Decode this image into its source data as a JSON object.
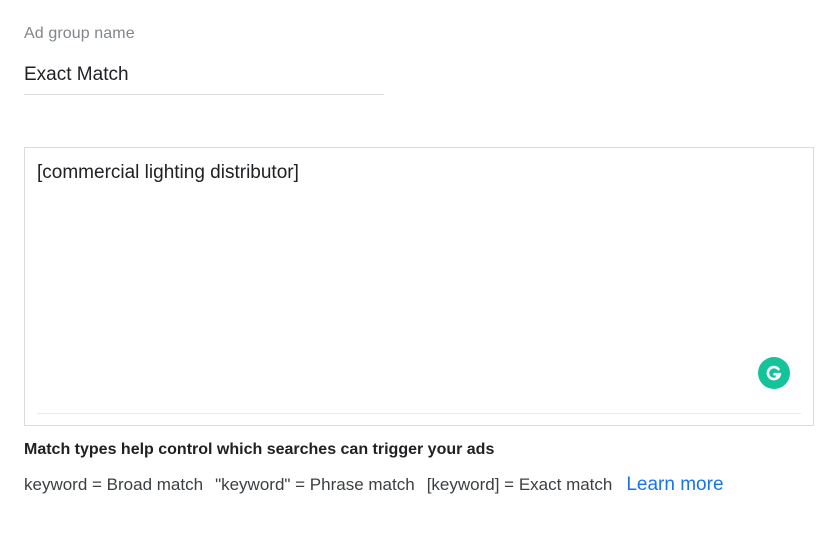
{
  "ad_group": {
    "label": "Ad group name",
    "value": "Exact Match"
  },
  "keywords": {
    "value": "[commercial lighting distributor]",
    "grammarly_icon": "grammarly-icon",
    "grammarly_color": "#15c39a"
  },
  "help": {
    "heading": "Match types help control which searches can trigger your ads",
    "broad": "keyword = Broad match",
    "phrase": "\"keyword\" = Phrase match",
    "exact": "[keyword] = Exact match",
    "learn_more": "Learn more",
    "link_color": "#1a73e8"
  }
}
